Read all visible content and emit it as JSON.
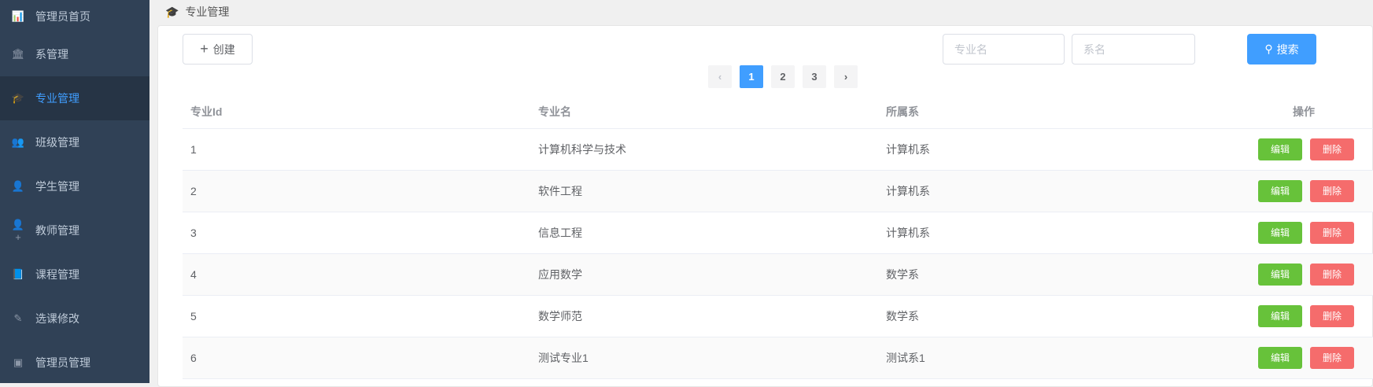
{
  "sidebar": {
    "items": [
      {
        "label": "管理员首页",
        "icon": "bar-chart-icon",
        "glyph": "📊"
      },
      {
        "label": "系管理",
        "icon": "building-icon",
        "glyph": "🏛"
      },
      {
        "label": "专业管理",
        "icon": "graduation-cap-icon",
        "glyph": "🎓",
        "active": true
      },
      {
        "label": "班级管理",
        "icon": "users-icon",
        "glyph": "👥"
      },
      {
        "label": "学生管理",
        "icon": "user-icon",
        "glyph": "👤"
      },
      {
        "label": "教师管理",
        "icon": "user-plus-icon",
        "glyph": "👤+"
      },
      {
        "label": "课程管理",
        "icon": "book-icon",
        "glyph": "📘"
      },
      {
        "label": "选课修改",
        "icon": "edit-icon",
        "glyph": "✎"
      },
      {
        "label": "管理员管理",
        "icon": "id-badge-icon",
        "glyph": "▣"
      }
    ]
  },
  "breadcrumb": {
    "title": "专业管理"
  },
  "toolbar": {
    "create_label": "创建",
    "major_placeholder": "专业名",
    "dept_placeholder": "系名",
    "search_label": "搜索"
  },
  "pagination": {
    "pages": [
      "1",
      "2",
      "3"
    ],
    "current": "1"
  },
  "table": {
    "headers": [
      "专业Id",
      "专业名",
      "所属系",
      "操作"
    ],
    "rows": [
      [
        "1",
        "计算机科学与技术",
        "计算机系"
      ],
      [
        "2",
        "软件工程",
        "计算机系"
      ],
      [
        "3",
        "信息工程",
        "计算机系"
      ],
      [
        "4",
        "应用数学",
        "数学系"
      ],
      [
        "5",
        "数学师范",
        "数学系"
      ],
      [
        "6",
        "测试专业1",
        "测试系1"
      ]
    ],
    "edit_label": "编辑",
    "delete_label": "删除"
  }
}
